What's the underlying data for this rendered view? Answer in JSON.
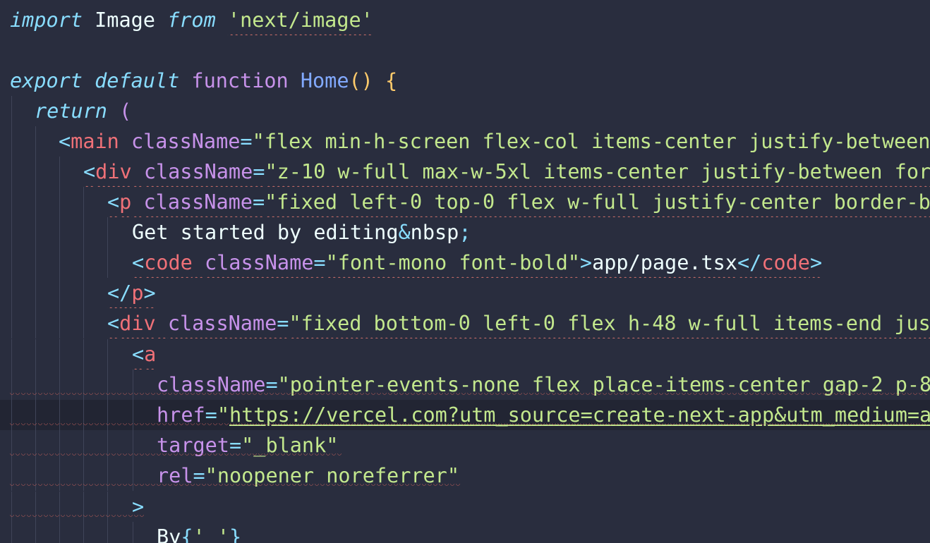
{
  "editor": {
    "partial_top_text": "",
    "lines": {
      "l1": {
        "import": "import",
        "ident": "Image",
        "from": "from",
        "module": "'next/image'"
      },
      "l3": {
        "export": "export",
        "default": "default",
        "function": "function",
        "name": "Home",
        "parens": "()",
        "brace": "{"
      },
      "l4": {
        "return": "return",
        "paren": "("
      },
      "l5": {
        "lt": "<",
        "tag": "main",
        "attr": "className",
        "eq": "=",
        "value": "\"flex min-h-screen flex-col items-center justify-between"
      },
      "l6": {
        "lt": "<",
        "tag": "div",
        "attr": "className",
        "eq": "=",
        "value": "\"z-10 w-full max-w-5xl items-center justify-between for"
      },
      "l7": {
        "lt": "<",
        "tag": "p",
        "attr": "className",
        "eq": "=",
        "value": "\"fixed left-0 top-0 flex w-full justify-center border-b"
      },
      "l8": {
        "text": "Get started by editing",
        "entity_amp": "&",
        "entity_name": "nbsp",
        "entity_semi": ";"
      },
      "l9": {
        "lt": "<",
        "tag": "code",
        "attr": "className",
        "eq": "=",
        "value": "\"font-mono font-bold\"",
        "gt": ">",
        "text": "app/page.tsx",
        "close_lt": "</",
        "close_tag": "code",
        "close_gt": ">"
      },
      "l10": {
        "lt": "</",
        "tag": "p",
        "gt": ">"
      },
      "l11": {
        "lt": "<",
        "tag": "div",
        "attr": "className",
        "eq": "=",
        "value": "\"fixed bottom-0 left-0 flex h-48 w-full items-end jus"
      },
      "l12": {
        "lt": "<",
        "tag": "a"
      },
      "l13": {
        "attr": "className",
        "eq": "=",
        "value": "\"pointer-events-none flex place-items-center gap-2 p-8"
      },
      "l14": {
        "attr": "href",
        "eq": "=",
        "quote": "\"",
        "url": "https://vercel.com?utm_source=create-next-app&utm_medium=a"
      },
      "l15": {
        "attr": "target",
        "eq": "=",
        "value": "\"_blank\""
      },
      "l16": {
        "attr": "rel",
        "eq": "=",
        "value": "\"noopener noreferrer\""
      },
      "l17": {
        "gt": ">"
      },
      "l18": {
        "text": "By",
        "open": "{",
        "value": "' '",
        "close": "}"
      }
    }
  },
  "colors": {
    "background": "#292d3e",
    "current_line": "#222533",
    "keyword_italic": "#89ddff",
    "keyword": "#c792ea",
    "function": "#82aaff",
    "string": "#c3e88d",
    "tag": "#f07178",
    "punctuation": "#89ddff",
    "bracket": "#ffcb6b",
    "text": "#eeffff",
    "squiggle": "#d0706a"
  }
}
